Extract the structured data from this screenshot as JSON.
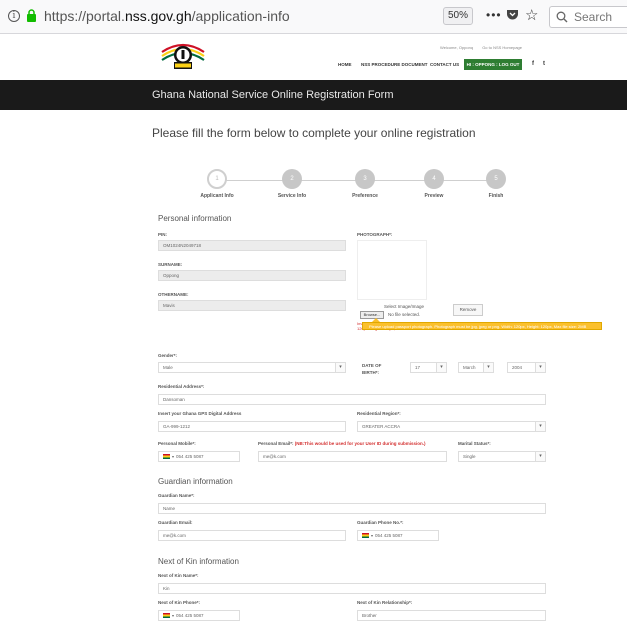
{
  "browser": {
    "url_prefix": "https://portal.",
    "url_domain": "nss.gov.gh",
    "url_path": "/application-info",
    "zoom": "50%",
    "search_placeholder": "Search",
    "dots": "•••"
  },
  "header": {
    "top_links": [
      "Welcome, Opponq",
      "Go to NSS Homepage"
    ],
    "nav": [
      "HOME",
      "NSS PROCEDURE DOCUMENT",
      "CONTACT US"
    ],
    "login_label": "HI : OPPONG : LOG OUT",
    "fb": "f",
    "tw": "t"
  },
  "banner": {
    "title": "Ghana National Service Online Registration Form"
  },
  "intro": "Please fill the form below to complete your online registration",
  "steps": [
    {
      "num": "1",
      "label": "Applicant Info"
    },
    {
      "num": "2",
      "label": "Service Info"
    },
    {
      "num": "3",
      "label": "Preference"
    },
    {
      "num": "4",
      "label": "Preview"
    },
    {
      "num": "5",
      "label": "Finish"
    }
  ],
  "personal": {
    "title": "Personal information",
    "pin_label": "PIN:",
    "pin_value": "OM1024N2049718",
    "surname_label": "SURNAME:",
    "surname_value": "Oppong",
    "othername_label": "OTHERNAME:",
    "othername_value": "Mavis",
    "photo_label": "PHOTOGRAPH*:",
    "select_image": "Select Image/Image",
    "remove": "Remove",
    "browse": "Browse...",
    "no_file": "No file selected.",
    "photo_note": "Images must have standard passport photograph background. Accepted types: jpg, jpeg, png. Max Width: 120px Height: 120px, Max File Size: 2MB",
    "tooltip": "Please upload passport photograph. Photograph must be jpg, jpeg or png. Width: 120px, Height: 120px, Max file size: 2MB",
    "gender_label": "Gender*:",
    "gender_value": "Male",
    "dob_label_1": "DATE OF",
    "dob_label_2": "BIRTH*:",
    "dob_day": "17",
    "dob_month": "March",
    "dob_year": "2004",
    "address_label": "Residential Address*:",
    "address_value": "Dansoman",
    "gps_label": "Insert your Ghana GPS Digital Address",
    "gps_value": "GA-999-1212",
    "region_label": "Residential Region*:",
    "region_value": "GREATER ACCRA",
    "mobile_label": "Personal Mobile*:",
    "mobile_value": "054 425 5087",
    "email_label": "Personal Email*:",
    "email_note": "(NB:This would be used for your User ID during submission.)",
    "email_value": "me@k.com",
    "marital_label": "Marital Status*:",
    "marital_value": "Single"
  },
  "guardian": {
    "title": "Guardian information",
    "name_label": "Guardian Name*:",
    "name_value": "Name",
    "email_label": "Guardian Email:",
    "email_value": "me@k.com",
    "phone_label": "Guardian Phone No.*:",
    "phone_value": "054 425 5087"
  },
  "kin": {
    "title": "Next of Kin information",
    "name_label": "Next of Kin Name*:",
    "name_value": "Kin",
    "phone_label": "Next of Kin Phone*:",
    "phone_value": "054 425 5087",
    "rel_label": "Next of Kin Relationship*:",
    "rel_value": "Brother"
  },
  "icons": {
    "arrow": "▾",
    "flag_caret": "▾",
    "star": "☆",
    "info": "i"
  },
  "colors": {
    "banner": "#1a1a1a",
    "login_green": "#2e7d32",
    "tooltip_yellow": "#fbc02d",
    "note_red": "#d32f2f"
  }
}
